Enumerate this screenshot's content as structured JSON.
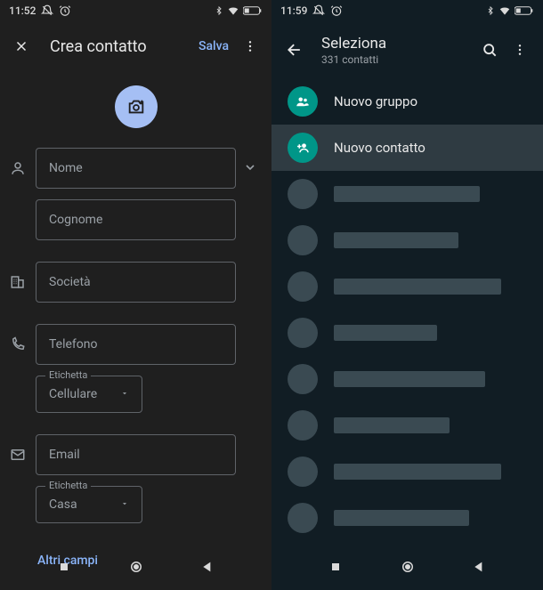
{
  "left": {
    "status": {
      "time": "11:52"
    },
    "appbar": {
      "title": "Crea contatto",
      "save": "Salva"
    },
    "fields": {
      "name": "Nome",
      "surname": "Cognome",
      "company": "Società",
      "phone": "Telefono",
      "phone_label_caption": "Etichetta",
      "phone_label_value": "Cellulare",
      "email": "Email",
      "email_label_caption": "Etichetta",
      "email_label_value": "Casa"
    },
    "more_fields": "Altri campi"
  },
  "right": {
    "status": {
      "time": "11:59"
    },
    "appbar": {
      "title": "Seleziona",
      "subtitle": "331 contatti"
    },
    "actions": {
      "new_group": "Nuovo gruppo",
      "new_contact": "Nuovo contatto"
    },
    "placeholder_widths": [
      164,
      140,
      188,
      116,
      170,
      130,
      188,
      152
    ]
  }
}
